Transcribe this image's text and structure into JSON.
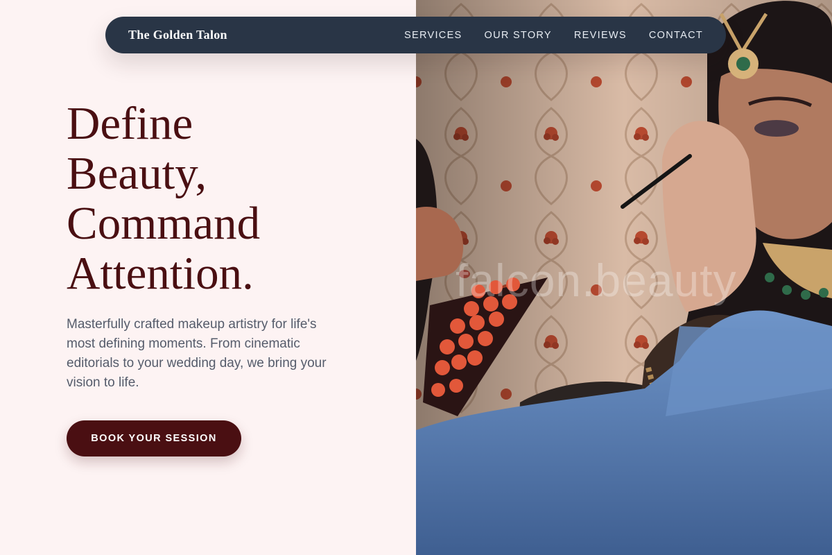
{
  "brand": {
    "name": "The Golden Talon"
  },
  "nav": {
    "links": [
      {
        "label": "SERVICES"
      },
      {
        "label": "OUR STORY"
      },
      {
        "label": "REVIEWS"
      },
      {
        "label": "CONTACT"
      }
    ]
  },
  "hero": {
    "headline_lines": [
      "Define",
      "Beauty,",
      "Command",
      "Attention."
    ],
    "description": "Masterfully crafted makeup artistry for life's most defining moments. From cinematic editorials to your wedding day, we bring your vision to life.",
    "cta_label": "BOOK YOUR SESSION",
    "image_watermark": "falcon.beauty"
  },
  "colors": {
    "page_background": "#fdf3f3",
    "navbar_background": "#293546",
    "accent_burgundy": "#4a0f12",
    "body_text": "#555c6b"
  }
}
